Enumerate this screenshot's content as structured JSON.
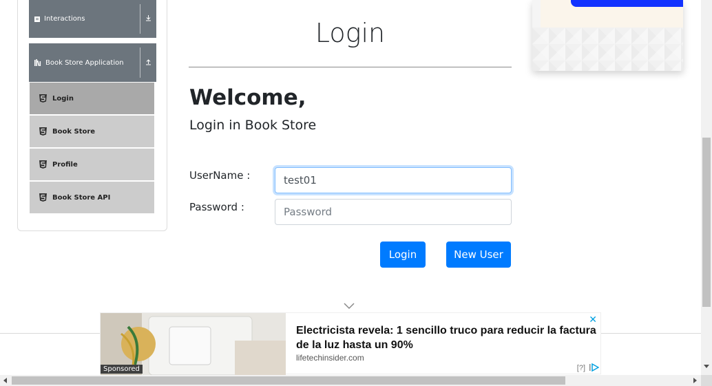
{
  "sidebar": {
    "groups": [
      {
        "label": "Interactions",
        "icon": "list-icon",
        "arrow": "download-arrow-icon"
      },
      {
        "label": "Book Store Application",
        "icon": "library-icon",
        "arrow": "upload-arrow-icon"
      }
    ],
    "items": [
      {
        "label": "Login",
        "icon": "html5-icon"
      },
      {
        "label": "Book Store",
        "icon": "html5-icon"
      },
      {
        "label": "Profile",
        "icon": "html5-icon"
      },
      {
        "label": "Book Store API",
        "icon": "html5-icon"
      }
    ]
  },
  "main": {
    "title": "Login",
    "welcome": "Welcome,",
    "subtitle": "Login in Book Store",
    "form": {
      "username_label": "UserName :",
      "username_value": "test01",
      "password_label": "Password :",
      "password_placeholder": "Password",
      "login_button": "Login",
      "new_user_button": "New User"
    }
  },
  "ad": {
    "headline": "Electricista revela: 1 sencillo truco para reducir la factura de la luz hasta un 90%",
    "domain": "lifetechinsider.com",
    "sponsored": "Sponsored",
    "info": "[?]",
    "close": "✕"
  },
  "colors": {
    "primary": "#007bff",
    "sidebar_header": "#6c757d",
    "menu_item": "#cccccc",
    "menu_item_active": "#a9a9a9"
  }
}
